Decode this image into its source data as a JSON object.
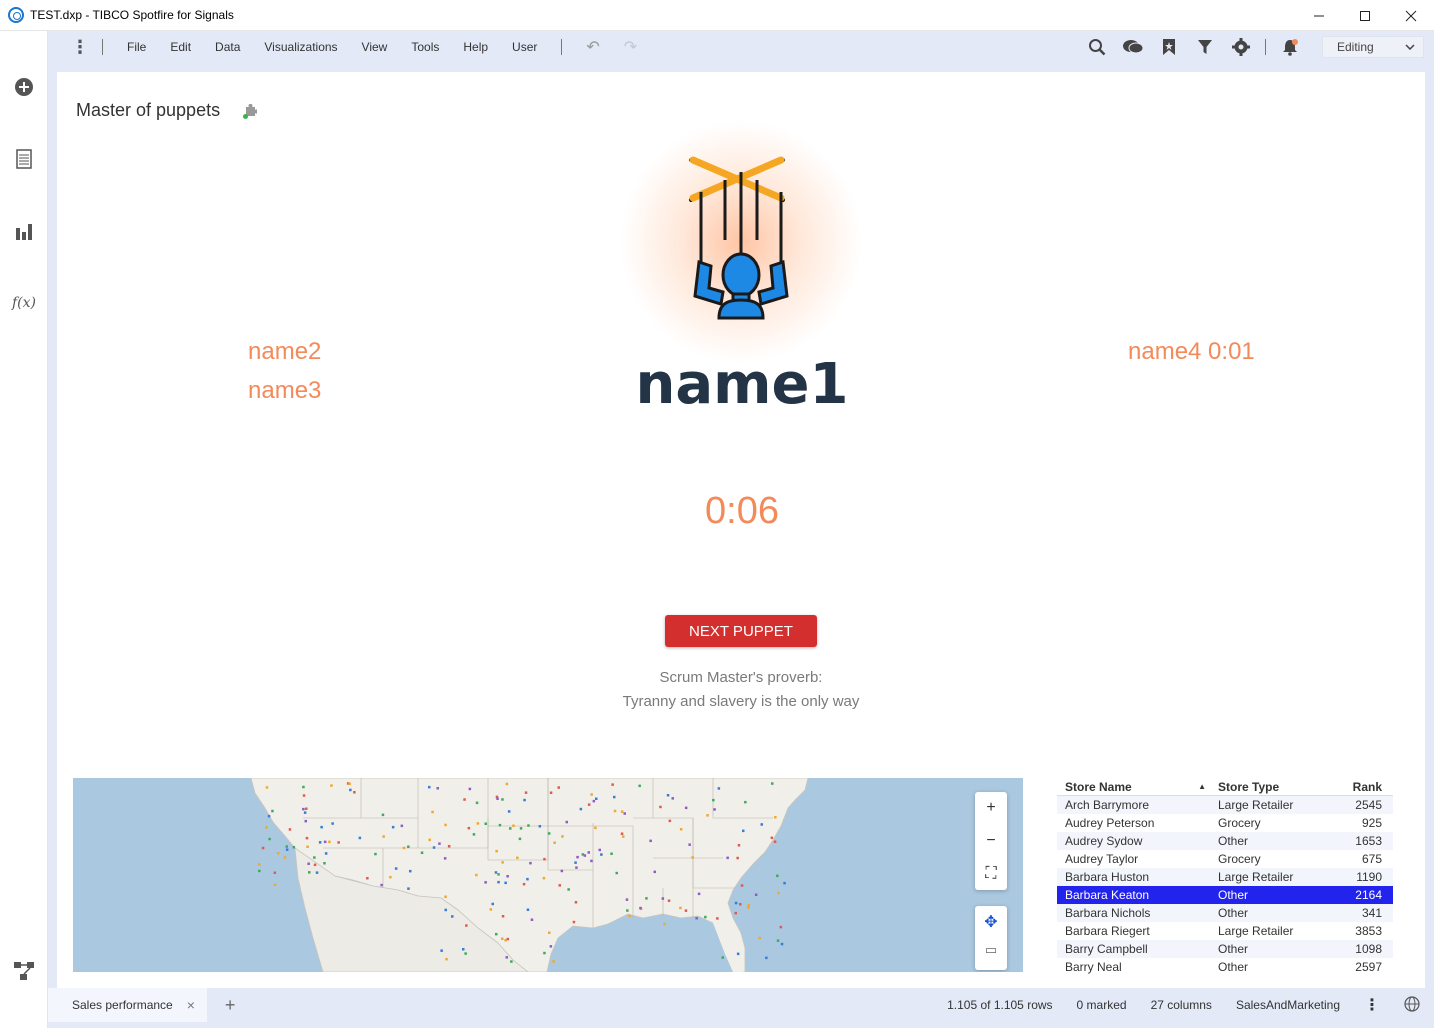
{
  "window": {
    "title": "TEST.dxp - TIBCO Spotfire for Signals",
    "controls": [
      "minimize-icon",
      "maximize-icon",
      "close-icon"
    ]
  },
  "menu": {
    "items": [
      "File",
      "Edit",
      "Data",
      "Visualizations",
      "View",
      "Tools",
      "Help",
      "User"
    ],
    "mode": "Editing"
  },
  "leftrail": {
    "icons": [
      "add-icon",
      "data-table-icon",
      "bar-chart-icon",
      "function-icon",
      "flow-icon"
    ]
  },
  "visualization": {
    "title": "Master of puppets",
    "main_name": "name1",
    "left_names": [
      "name2",
      "name3"
    ],
    "right_name": "name4 0:01",
    "timer": "0:06",
    "button_label": "NEXT PUPPET",
    "proverb_title": "Scrum Master's proverb:",
    "proverb_text": "Tyranny and slavery is the only way",
    "accent_color": "#f28a5a",
    "button_color": "#d32f2f"
  },
  "table": {
    "headers": [
      "Store Name",
      "Store Type",
      "Rank"
    ],
    "sort_indicator": "▲",
    "rows": [
      [
        "Arch Barrymore",
        "Large Retailer",
        "2545"
      ],
      [
        "Audrey Peterson",
        "Grocery",
        "925"
      ],
      [
        "Audrey Sydow",
        "Other",
        "1653"
      ],
      [
        "Audrey Taylor",
        "Grocery",
        "675"
      ],
      [
        "Barbara Huston",
        "Large Retailer",
        "1190"
      ],
      [
        "Barbara Keaton",
        "Other",
        "2164"
      ],
      [
        "Barbara Nichols",
        "Other",
        "341"
      ],
      [
        "Barbara Riegert",
        "Large Retailer",
        "3853"
      ],
      [
        "Barry Campbell",
        "Other",
        "1098"
      ],
      [
        "Barry Neal",
        "Other",
        "2597"
      ]
    ],
    "selected_row": 5
  },
  "status": {
    "page_tab": "Sales performance",
    "rows": "1.105 of 1.105 rows",
    "marked": "0 marked",
    "columns": "27 columns",
    "source": "SalesAndMarketing"
  }
}
